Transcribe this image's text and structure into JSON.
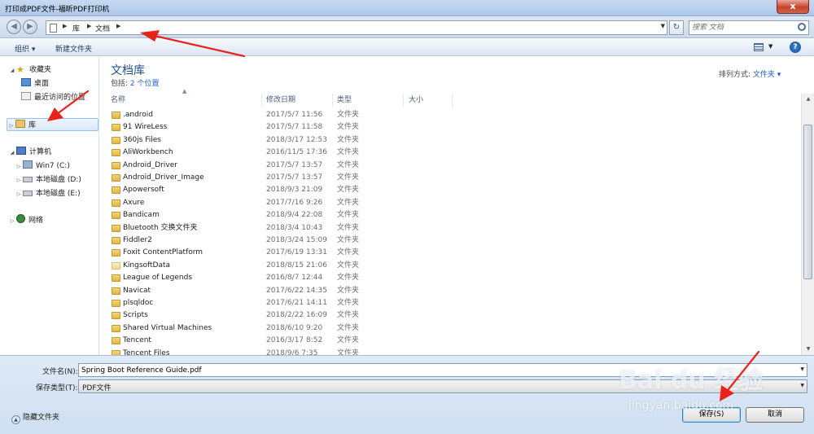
{
  "window": {
    "title": "打印成PDF文件-福昕PDF打印机",
    "close_label": "x"
  },
  "address": {
    "crumbs": [
      "库",
      "文档"
    ],
    "search_placeholder": "搜索 文档"
  },
  "toolbar": {
    "organize_label": "组织 ▾",
    "new_folder_label": "新建文件夹"
  },
  "nav": {
    "favorites": "收藏夹",
    "desktop": "桌面",
    "recent": "最近访问的位置",
    "libraries": "库",
    "computer": "计算机",
    "drive_c": "Win7 (C:)",
    "drive_d": "本地磁盘 (D:)",
    "drive_e": "本地磁盘 (E:)",
    "network": "网络"
  },
  "main": {
    "library_title": "文档库",
    "includes_label": "包括:",
    "includes_link": "2 个位置",
    "arrange_label": "排列方式:",
    "arrange_value": "文件夹 ▾",
    "columns": [
      "名称",
      "修改日期",
      "类型",
      "大小"
    ],
    "files": [
      {
        "name": ".android",
        "date": "2017/5/7 11:56",
        "type": "文件夹"
      },
      {
        "name": "91 WireLess",
        "date": "2017/5/7 11:58",
        "type": "文件夹"
      },
      {
        "name": "360js Files",
        "date": "2018/3/17 12:53",
        "type": "文件夹"
      },
      {
        "name": "AliWorkbench",
        "date": "2016/11/5 17:36",
        "type": "文件夹"
      },
      {
        "name": "Android_Driver",
        "date": "2017/5/7 13:57",
        "type": "文件夹"
      },
      {
        "name": "Android_Driver_Image",
        "date": "2017/5/7 13:57",
        "type": "文件夹"
      },
      {
        "name": "Apowersoft",
        "date": "2018/9/3 21:09",
        "type": "文件夹"
      },
      {
        "name": "Axure",
        "date": "2017/7/16 9:26",
        "type": "文件夹"
      },
      {
        "name": "Bandicam",
        "date": "2018/9/4 22:08",
        "type": "文件夹"
      },
      {
        "name": "Bluetooth 交换文件夹",
        "date": "2018/3/4 10:43",
        "type": "文件夹"
      },
      {
        "name": "Fiddler2",
        "date": "2018/3/24 15:09",
        "type": "文件夹"
      },
      {
        "name": "Foxit ContentPlatform",
        "date": "2017/6/19 13:31",
        "type": "文件夹"
      },
      {
        "name": "KingsoftData",
        "date": "2018/8/15 21:06",
        "type": "文件夹"
      },
      {
        "name": "League of Legends",
        "date": "2016/8/7 12:44",
        "type": "文件夹"
      },
      {
        "name": "Navicat",
        "date": "2017/6/22 14:35",
        "type": "文件夹"
      },
      {
        "name": "plsqldoc",
        "date": "2017/6/21 14:11",
        "type": "文件夹"
      },
      {
        "name": "Scripts",
        "date": "2018/2/22 16:09",
        "type": "文件夹"
      },
      {
        "name": "Shared Virtual Machines",
        "date": "2018/6/10 9:20",
        "type": "文件夹"
      },
      {
        "name": "Tencent",
        "date": "2016/3/17 8:52",
        "type": "文件夹"
      },
      {
        "name": "Tencent Files",
        "date": "2018/9/6 7:35",
        "type": "文件夹"
      }
    ]
  },
  "bottom": {
    "filename_label": "文件名(N):",
    "filename_value": "Spring Boot Reference Guide.pdf",
    "filetype_label": "保存类型(T):",
    "filetype_value": "PDF文件",
    "hide_folders_label": "隐藏文件夹",
    "save_label": "保存(S)",
    "cancel_label": "取消"
  },
  "watermark": {
    "line1": "Bai du 经验",
    "line2": "jingyan.baidu.com"
  },
  "colors": {
    "accent": "#1e4e8c",
    "link": "#1f62c6",
    "annotation_arrow": "#e8231c"
  }
}
